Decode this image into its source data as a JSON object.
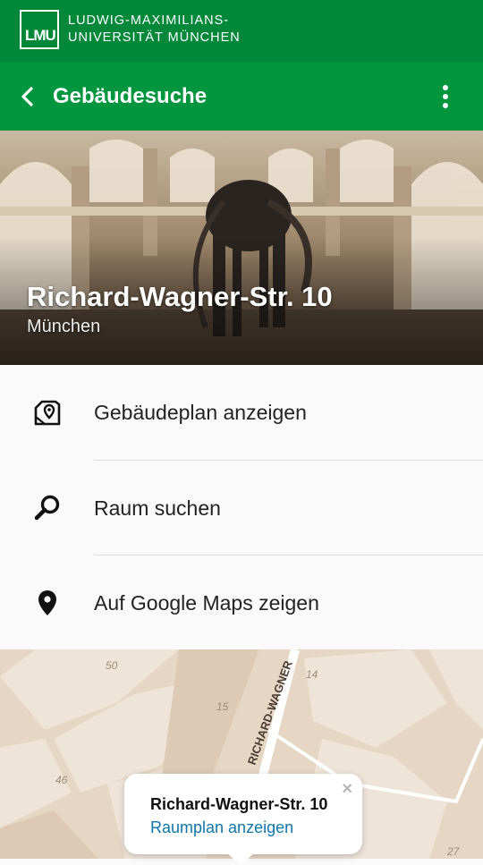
{
  "brand": {
    "logo_text": "LMU",
    "line1": "LUDWIG-MAXIMILIANS-",
    "line2": "UNIVERSITÄT MÜNCHEN"
  },
  "appbar": {
    "title": "Gebäudesuche",
    "back_icon": "chevron-left-icon",
    "menu_icon": "more-vert-icon"
  },
  "building": {
    "address": "Richard-Wagner-Str. 10",
    "city": "München"
  },
  "menu": [
    {
      "label": "Gebäudeplan anzeigen",
      "icon": "map-pin-icon"
    },
    {
      "label": "Raum suchen",
      "icon": "search-icon"
    },
    {
      "label": "Auf Google Maps zeigen",
      "icon": "location-pin-icon"
    }
  ],
  "map": {
    "street_label": "RICHARD-WAGNER",
    "house_numbers": [
      "50",
      "14",
      "15",
      "46",
      "27"
    ]
  },
  "popup": {
    "title": "Richard-Wagner-Str. 10",
    "link": "Raumplan anzeigen",
    "close": "×"
  },
  "colors": {
    "brand_green": "#00883a",
    "appbar_green": "#00963f",
    "link_blue": "#0f76a8",
    "map_bg": "#e6d6c4"
  }
}
